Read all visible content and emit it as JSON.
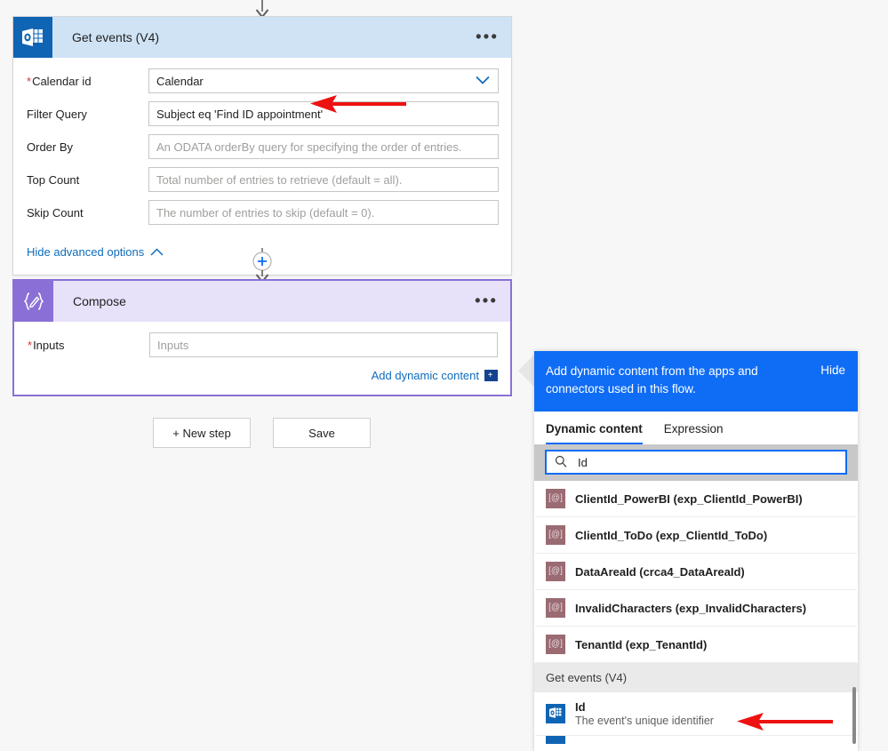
{
  "canvas": {
    "background": "#f7f7f7"
  },
  "colors": {
    "accent_blue": "#0f6cf5",
    "link_blue": "#0f6cbd",
    "outlook_blue": "#0f64b4",
    "compose_purple": "#8a70d6",
    "getevents_header": "#cfe3f5",
    "compose_header": "#e7e1fa",
    "dynamic_icon": "#9a6b72",
    "required_red": "#d13438",
    "annotation_red": "#ee1111"
  },
  "get_events_card": {
    "title": "Get events (V4)",
    "icon": "outlook-calendar-icon",
    "overflow_label": "•••",
    "fields": [
      {
        "label": "Calendar id",
        "required": true,
        "value": "Calendar",
        "placeholder": "",
        "has_dropdown": true
      },
      {
        "label": "Filter Query",
        "required": false,
        "value": "Subject eq 'Find ID appointment'",
        "placeholder": "",
        "has_dropdown": false
      },
      {
        "label": "Order By",
        "required": false,
        "value": "",
        "placeholder": "An ODATA orderBy query for specifying the order of entries.",
        "has_dropdown": false
      },
      {
        "label": "Top Count",
        "required": false,
        "value": "",
        "placeholder": "Total number of entries to retrieve (default = all).",
        "has_dropdown": false
      },
      {
        "label": "Skip Count",
        "required": false,
        "value": "",
        "placeholder": "The number of entries to skip (default = 0).",
        "has_dropdown": false
      }
    ],
    "advanced_options_label": "Hide advanced options"
  },
  "compose_card": {
    "title": "Compose",
    "icon": "compose-braces-pencil-icon",
    "overflow_label": "•••",
    "input_label": "Inputs",
    "input_required": true,
    "input_value": "",
    "input_placeholder": "Inputs",
    "add_dynamic_content_label": "Add dynamic content",
    "add_dynamic_content_badge": "+"
  },
  "flow_buttons": {
    "new_step": "+ New step",
    "save": "Save"
  },
  "dynamic_panel": {
    "header_text": "Add dynamic content from the apps and connectors used in this flow.",
    "hide_label": "Hide",
    "tabs": [
      {
        "label": "Dynamic content",
        "active": true
      },
      {
        "label": "Expression",
        "active": false
      }
    ],
    "search": {
      "value": "Id",
      "placeholder": "",
      "icon": "search-icon"
    },
    "items": [
      {
        "label": "ClientId_PowerBI (exp_ClientId_PowerBI)",
        "icon": "expression-variable-icon"
      },
      {
        "label": "ClientId_ToDo (exp_ClientId_ToDo)",
        "icon": "expression-variable-icon"
      },
      {
        "label": "DataAreaId (crca4_DataAreaId)",
        "icon": "expression-variable-icon"
      },
      {
        "label": "InvalidCharacters (exp_InvalidCharacters)",
        "icon": "expression-variable-icon"
      },
      {
        "label": "TenantId (exp_TenantId)",
        "icon": "expression-variable-icon"
      }
    ],
    "group": {
      "header": "Get events (V4)",
      "items": [
        {
          "label": "Id",
          "description": "The event's unique identifier",
          "icon": "outlook-calendar-icon"
        }
      ]
    }
  },
  "annotations": [
    {
      "name": "filter-query-arrow",
      "direction": "left"
    },
    {
      "name": "dynamic-id-arrow",
      "direction": "left"
    }
  ]
}
